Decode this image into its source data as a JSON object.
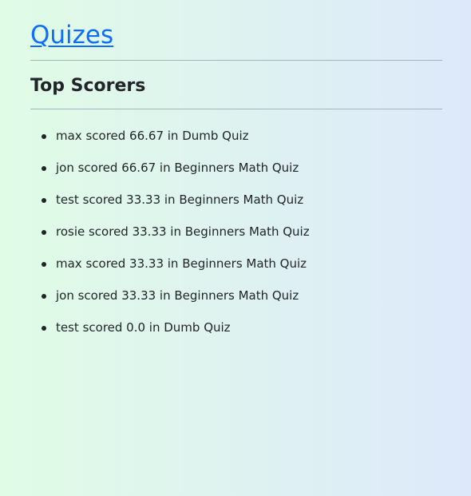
{
  "header": {
    "brand": "Quizes"
  },
  "main": {
    "heading": "Top Scorers",
    "scores": [
      "max scored 66.67 in Dumb Quiz",
      "jon scored 66.67 in Beginners Math Quiz",
      "test scored 33.33 in Beginners Math Quiz",
      "rosie scored 33.33 in Beginners Math Quiz",
      "max scored 33.33 in Beginners Math Quiz",
      "jon scored 33.33 in Beginners Math Quiz",
      "test scored 0.0 in Dumb Quiz"
    ]
  },
  "colors": {
    "link": "#0d6efd",
    "text": "#212529",
    "background_left": "#e0fce6",
    "background_right": "#dde9fb"
  }
}
